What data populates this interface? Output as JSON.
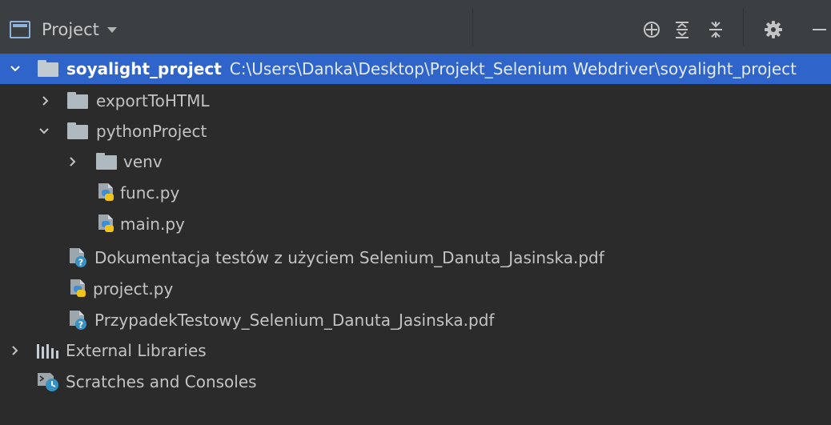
{
  "header": {
    "title": "Project",
    "icons": [
      "project-view-icon",
      "locate-icon",
      "expand-all-icon",
      "collapse-all-icon",
      "gear-icon",
      "hide-icon"
    ]
  },
  "tree": {
    "root": {
      "name": "soyalight_project",
      "path": "C:\\Users\\Danka\\Desktop\\Projekt_Selenium Webdriver\\soyalight_project"
    },
    "items": [
      {
        "label": "exportToHTML",
        "type": "folder",
        "expanded": false
      },
      {
        "label": "pythonProject",
        "type": "folder",
        "expanded": true
      },
      {
        "label": "venv",
        "type": "folder",
        "expanded": false
      },
      {
        "label": "func.py",
        "type": "python-file"
      },
      {
        "label": "main.py",
        "type": "python-file"
      },
      {
        "label": "Dokumentacja testów z użyciem Selenium_Danuta_Jasinska.pdf",
        "type": "unknown-file"
      },
      {
        "label": "project.py",
        "type": "python-file"
      },
      {
        "label": "PrzypadekTestowy_Selenium_Danuta_Jasinska.pdf",
        "type": "unknown-file"
      },
      {
        "label": "External Libraries",
        "type": "libraries",
        "expanded": false
      },
      {
        "label": "Scratches and Consoles",
        "type": "scratches"
      }
    ]
  },
  "colors": {
    "background": "#2b2b2b",
    "header": "#3c3f41",
    "selection": "#2f65ca",
    "text": "#c3c3c3",
    "folder": "#aeb9c0"
  }
}
